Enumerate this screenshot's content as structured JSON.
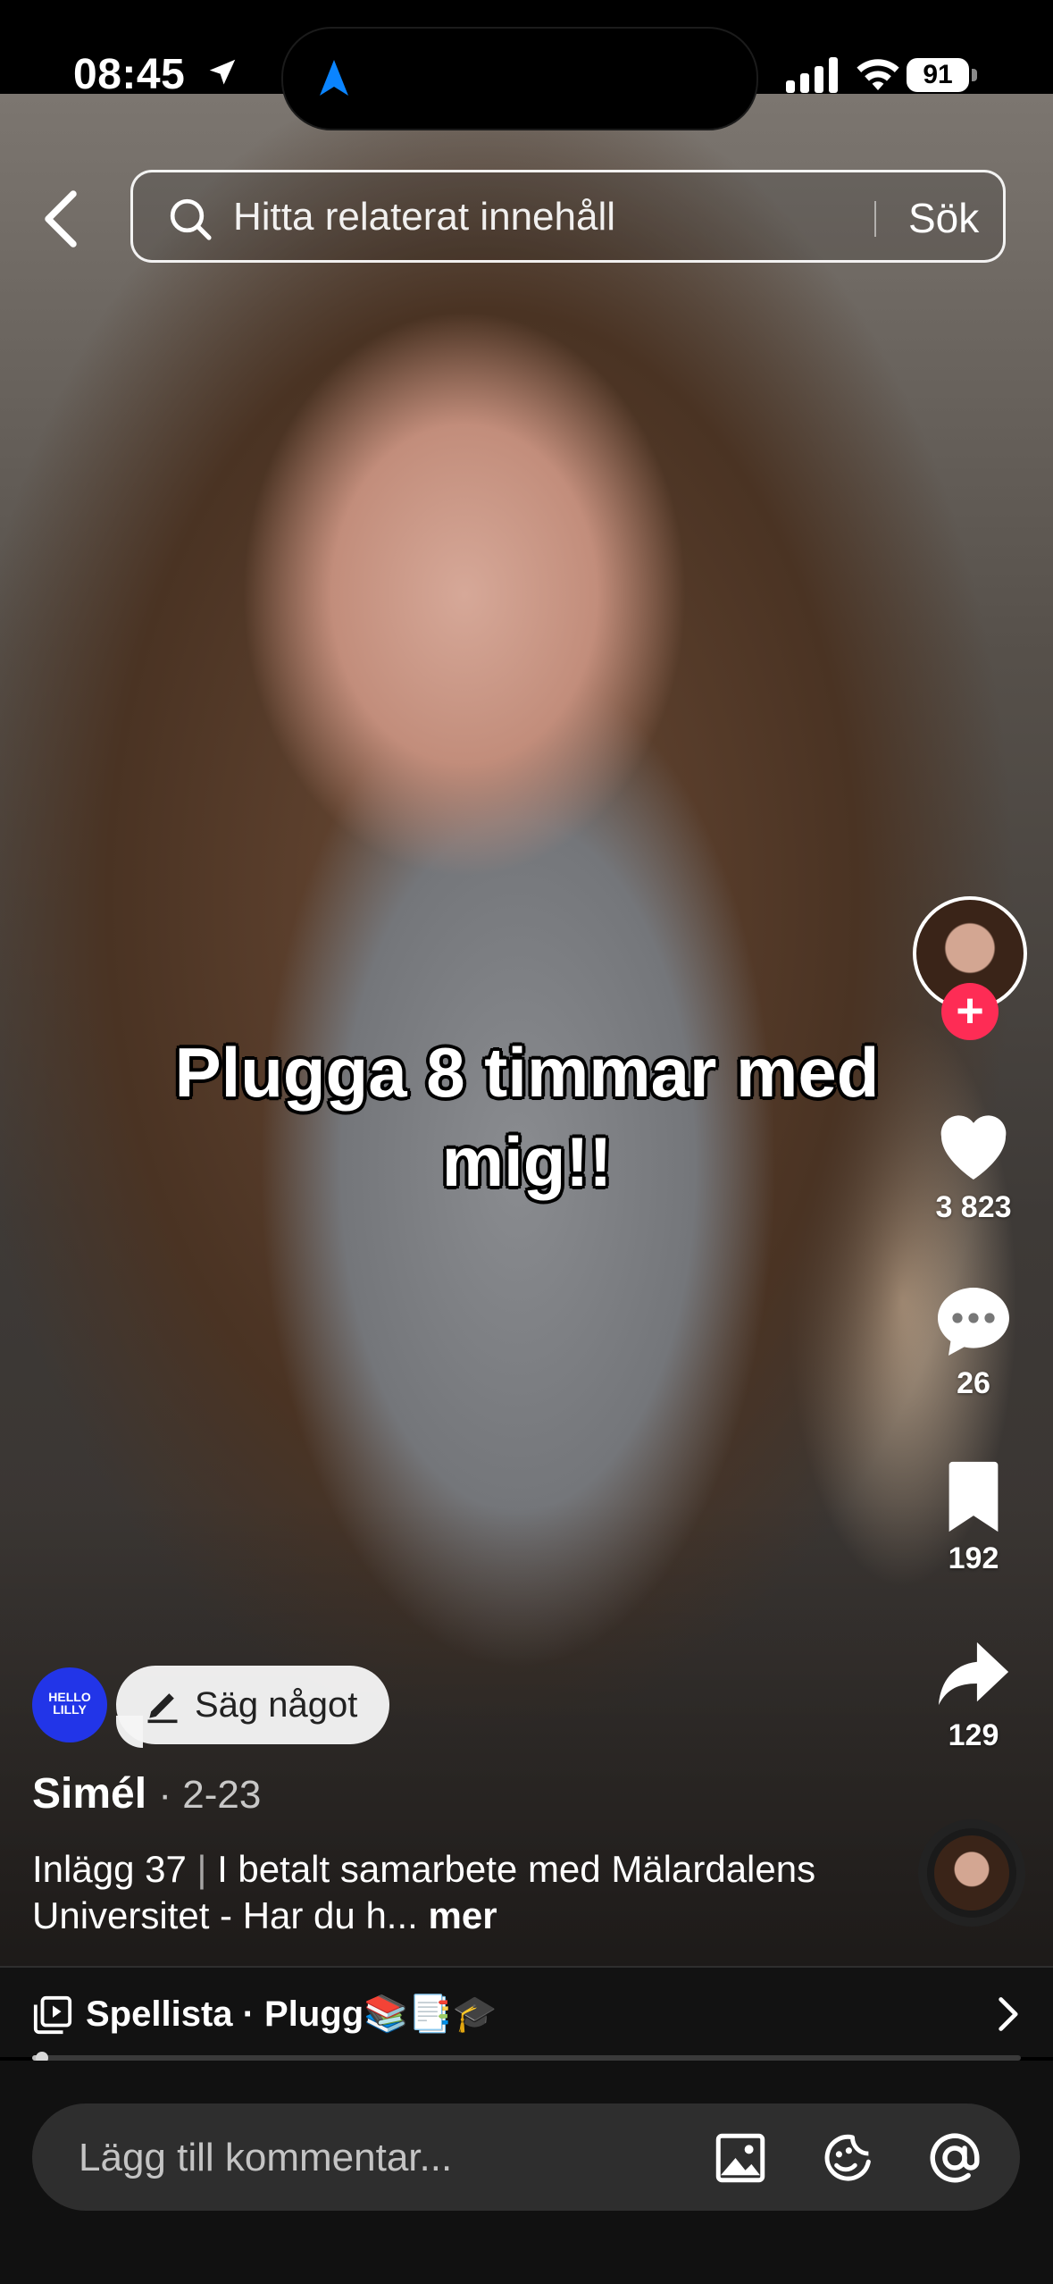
{
  "status_bar": {
    "time": "08:45",
    "battery": "91"
  },
  "search": {
    "placeholder": "Hitta relaterat innehåll",
    "button_label": "Sök"
  },
  "video": {
    "overlay_text": "Plugga 8 timmar med mig!!"
  },
  "actions": {
    "likes": "3 823",
    "comments": "26",
    "saves": "192",
    "shares": "129"
  },
  "creator": {
    "brand_badge": "HELLO LILLY",
    "say_something": "Säg något",
    "name": "Simél",
    "date": "· 2-23"
  },
  "description": {
    "posts": "Inlägg 37",
    "separator": "|",
    "text": "I betalt samarbete med Mälardalens Universitet - Har du h...",
    "more": "mer"
  },
  "playlist": {
    "label": "Spellista · Plugg📚📑🎓",
    "progress": 0.01
  },
  "comment": {
    "placeholder": "Lägg till kommentar..."
  },
  "icons": {
    "location": "location-arrow-icon",
    "navigation": "navigation-arrow-icon",
    "back": "chevron-left-icon",
    "search": "search-icon",
    "like": "heart-icon",
    "comment": "comment-bubble-icon",
    "save": "bookmark-icon",
    "share": "share-arrow-icon",
    "playlist": "playlist-icon",
    "image": "image-icon",
    "emoji": "emoji-icon",
    "mention": "at-icon"
  },
  "colors": {
    "accent": "#fe2c55",
    "nav_arrow": "#0a84ff",
    "brand_logo": "#2235e8"
  }
}
